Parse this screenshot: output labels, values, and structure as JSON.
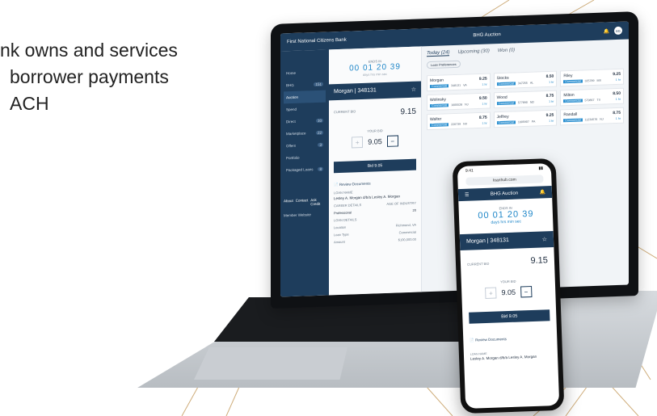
{
  "intro": {
    "line1": "nk owns and services",
    "line2": "borrower payments",
    "line3": "ACH"
  },
  "colors": {
    "brand_navy": "#1e3d5c",
    "accent_blue": "#1e86c8",
    "tag_blue": "#2a8fd0",
    "decor_lines": "#c9a36a"
  },
  "laptop": {
    "topbar": {
      "bank_name": "First National Citizens Bank",
      "app_title": "BHG Auction",
      "avatar": "BG"
    },
    "sidebar": {
      "items": [
        {
          "label": "Home",
          "badge": ""
        },
        {
          "label": "BHG",
          "badge": "151"
        },
        {
          "label": "Auction",
          "badge": ""
        },
        {
          "label": "Spend",
          "badge": ""
        },
        {
          "label": "Direct",
          "badge": "10"
        },
        {
          "label": "Marketplace",
          "badge": "22"
        },
        {
          "label": "Offers",
          "badge": "3"
        },
        {
          "label": "Portfolio",
          "badge": ""
        },
        {
          "label": "Packaged Loans",
          "badge": "8"
        }
      ],
      "links": [
        "About",
        "Contact",
        "Ask Credit"
      ],
      "website": "Member Website"
    },
    "detail": {
      "ends_in_label": "ENDS IN",
      "countdown": "00 01 20 39",
      "countdown_units": "days hrs min sec",
      "banner_name": "Morgan | 348131",
      "current_bid_label": "CURRENT BID",
      "current_bid": "9.15",
      "your_bid_label": "YOUR BID",
      "your_bid": "9.05",
      "bid_button": "Bid 9.05",
      "review_label": "Review Documents",
      "loan_name_label": "LOAN NAME",
      "loan_name": "Lesley A. Morgan d/b/a Lesley A. Morgan",
      "career_label": "CAREER DETAILS",
      "career_value": "Professional",
      "term_label": "AGE OF INDUSTRY",
      "term_value": "20",
      "loan_details_label": "LOAN DETAILS",
      "location_label": "Location",
      "location_value": "Richmond, VA",
      "loan_type_label": "Loan Type",
      "loan_type_value": "Commercial",
      "amount_label": "Amount",
      "amount_value": "$100,000.00"
    },
    "main": {
      "tabs": [
        "Today (24)",
        "Upcoming (30)",
        "Won (0)"
      ],
      "pref_button": "Loan Preferences",
      "cards": [
        {
          "name": "Morgan",
          "rate": "9.25",
          "tag": "Commercial",
          "id": "348131",
          "state": "VA",
          "term": "1 hr"
        },
        {
          "name": "Stocks",
          "rate": "8.50",
          "tag": "Commercial",
          "id": "347255",
          "state": "AL",
          "term": "1 hr"
        },
        {
          "name": "Riley",
          "rate": "9.25",
          "tag": "Commercial",
          "id": "325789",
          "state": "MS",
          "term": "1 hr"
        },
        {
          "name": "Wolinsky",
          "rate": "9.50",
          "tag": "Commercial",
          "id": "1005528",
          "state": "NJ",
          "term": "1 hr"
        },
        {
          "name": "Wood",
          "rate": "8.75",
          "tag": "Commercial",
          "id": "577890",
          "state": "ND",
          "term": "1 hr"
        },
        {
          "name": "Milton",
          "rate": "8.50",
          "tag": "Commercial",
          "id": "579867",
          "state": "TX",
          "term": "1 hr"
        },
        {
          "name": "Walter",
          "rate": "8.75",
          "tag": "Commercial",
          "id": "220739",
          "state": "NV",
          "term": "1 hr"
        },
        {
          "name": "Jeffrey",
          "rate": "9.25",
          "tag": "Commercial",
          "id": "1005907",
          "state": "PA",
          "term": "1 hr"
        },
        {
          "name": "Randall",
          "rate": "8.75",
          "tag": "Commercial",
          "id": "11234576",
          "state": "NJ",
          "term": "1 hr"
        }
      ]
    }
  },
  "phone": {
    "time": "9:41",
    "url": "loanhub.com",
    "nav_title": "BHG Auction",
    "ends_in_label": "ENDS IN",
    "countdown": "00 01 20 39",
    "countdown_units": "days hrs min sec",
    "banner_name": "Morgan | 348131",
    "current_bid_label": "CURRENT BID",
    "current_bid": "9.15",
    "your_bid_label": "YOUR BID",
    "your_bid": "9.05",
    "bid_button": "Bid 9.05",
    "review_label": "Review Documents",
    "loan_name_label": "LOAN NAME",
    "loan_name": "Lesley A. Morgan d/b/a Lesley A. Morgan"
  }
}
